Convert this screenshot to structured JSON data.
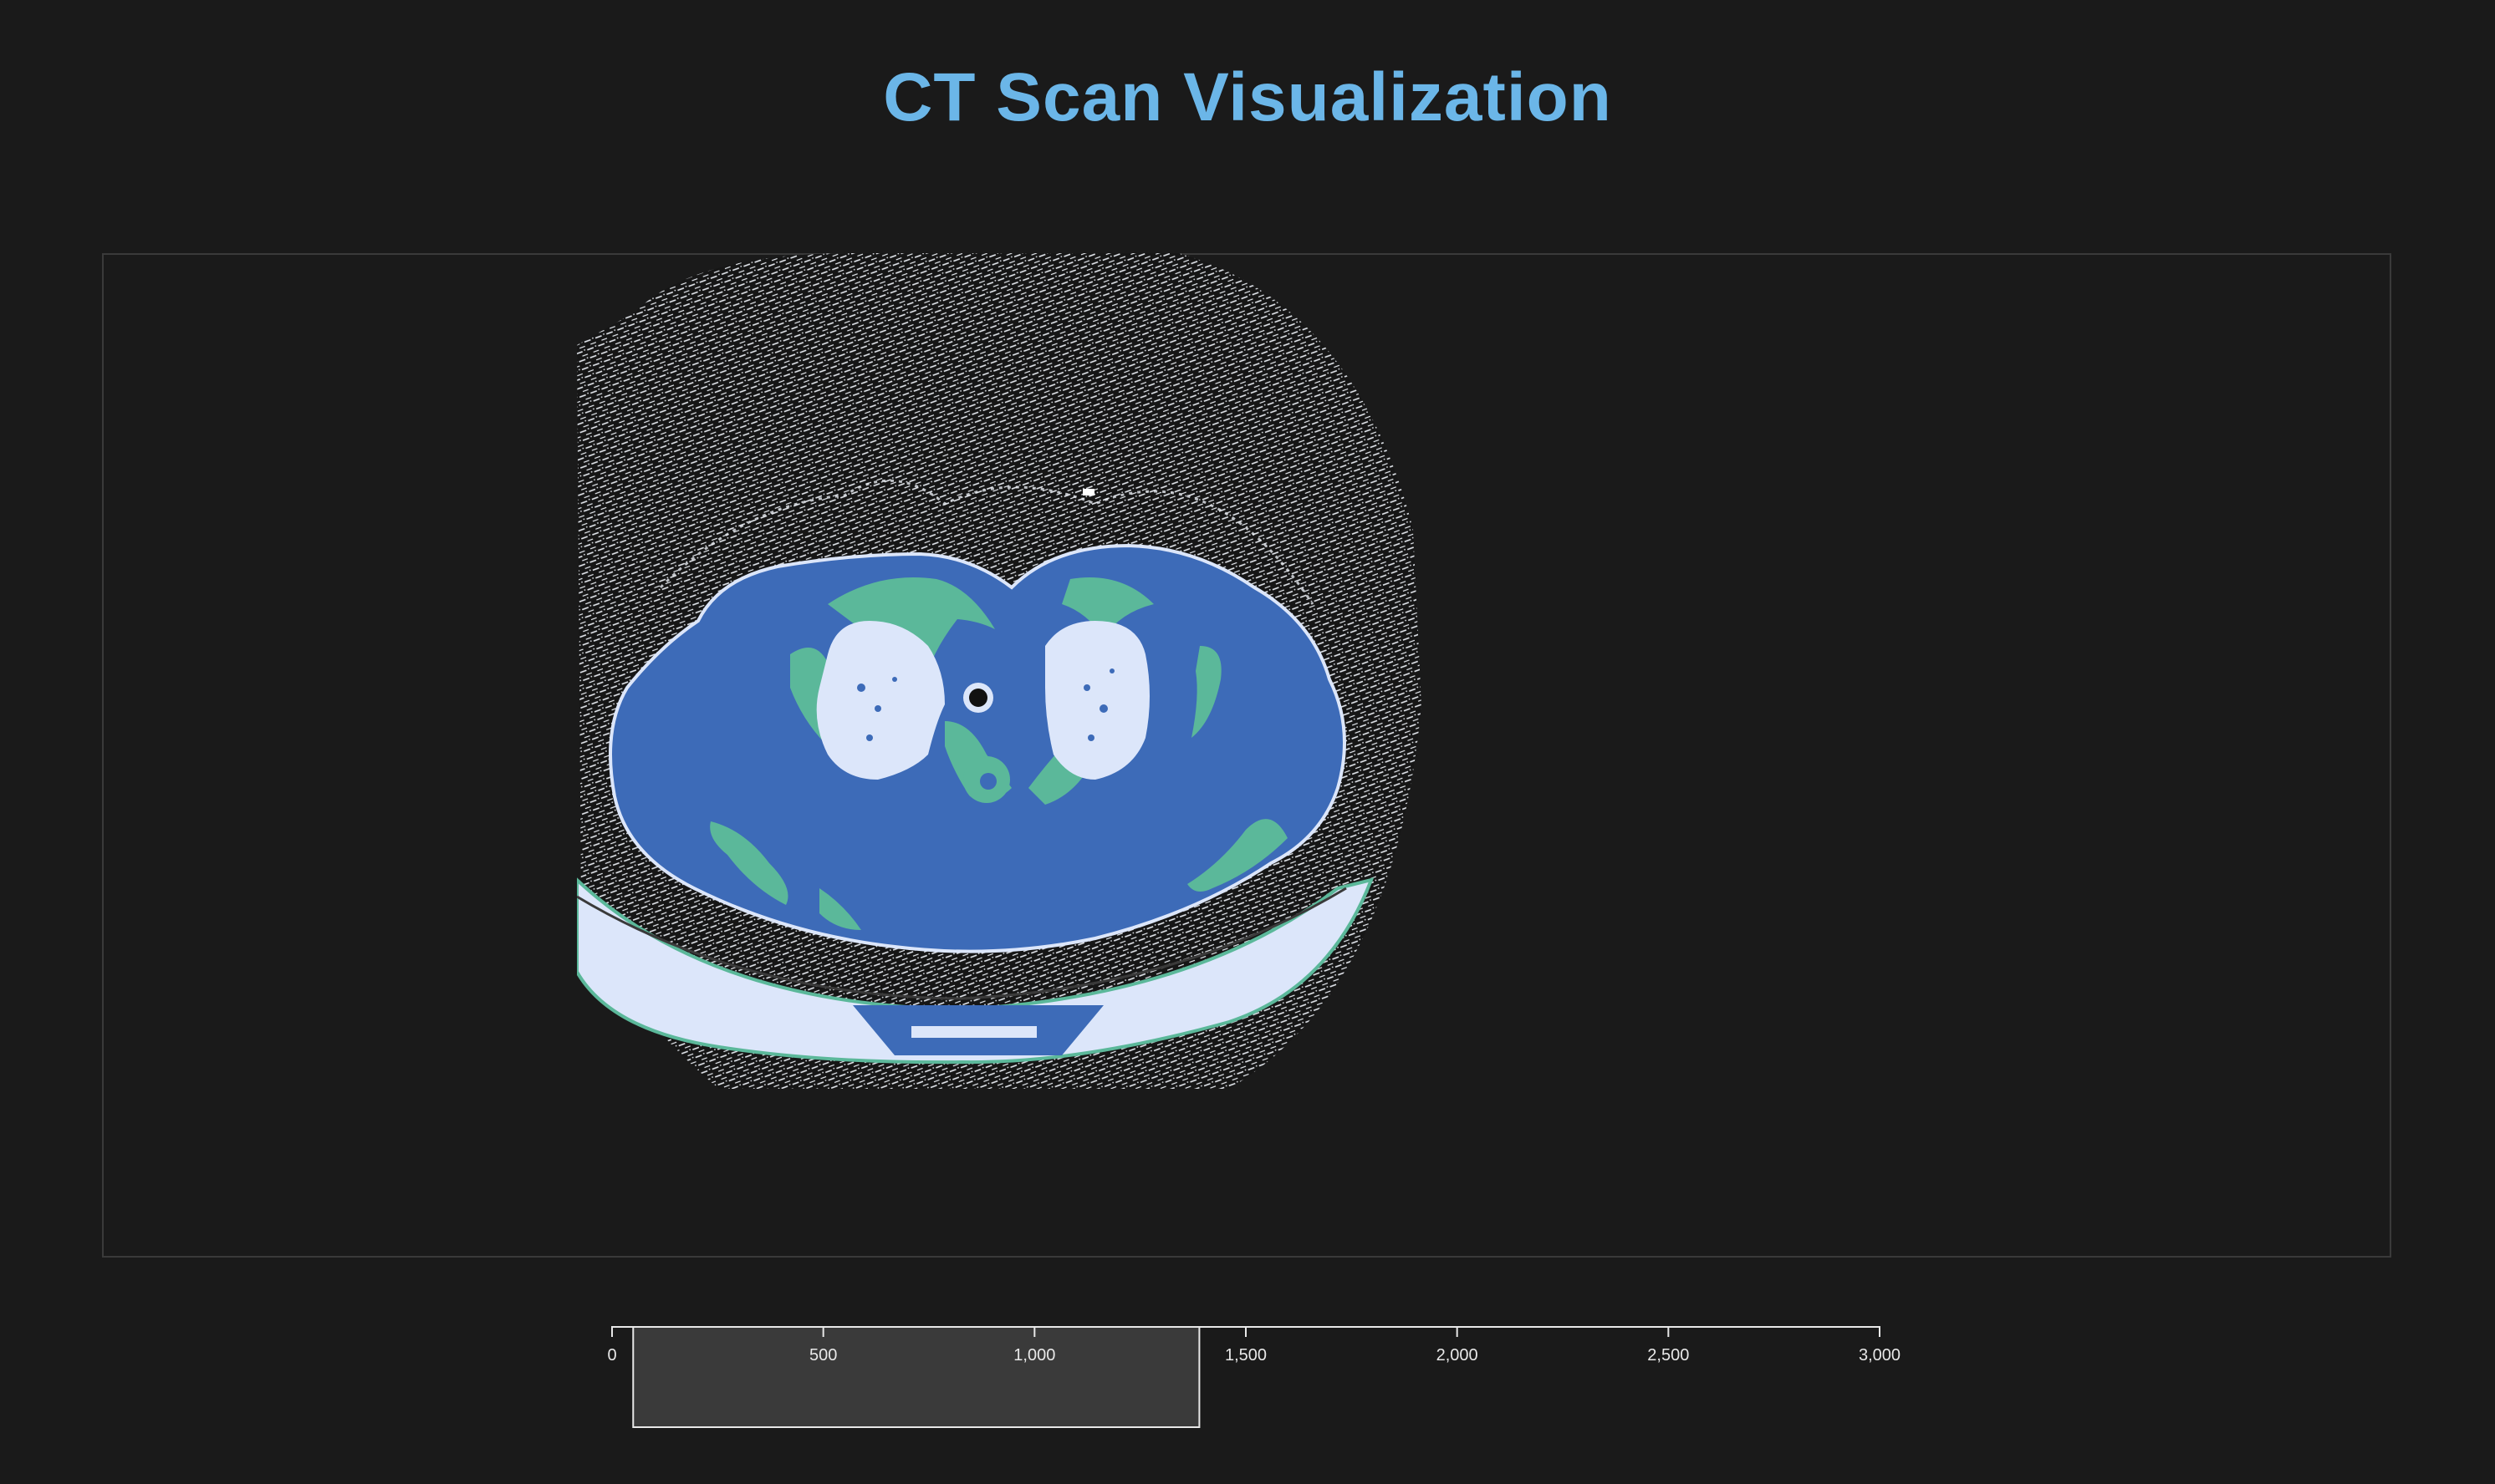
{
  "title": "CT Scan Visualization",
  "scale": {
    "min": 0,
    "max": 3000,
    "ticks": [
      {
        "value": 0,
        "label": "0"
      },
      {
        "value": 500,
        "label": "500"
      },
      {
        "value": 1000,
        "label": "1,000"
      },
      {
        "value": 1500,
        "label": "1,500"
      },
      {
        "value": 2000,
        "label": "2,000"
      },
      {
        "value": 2500,
        "label": "2,500"
      },
      {
        "value": 3000,
        "label": "3,000"
      }
    ],
    "brush_range": [
      50,
      1390
    ]
  },
  "colors": {
    "background": "#1a1a1a",
    "title": "#6bb6e8",
    "soft_tissue": "#3d6bb8",
    "bone": "#5bb89a",
    "air": "#dce6fa",
    "noise": "#e8ecf2",
    "brush": "#3a3a3a"
  }
}
